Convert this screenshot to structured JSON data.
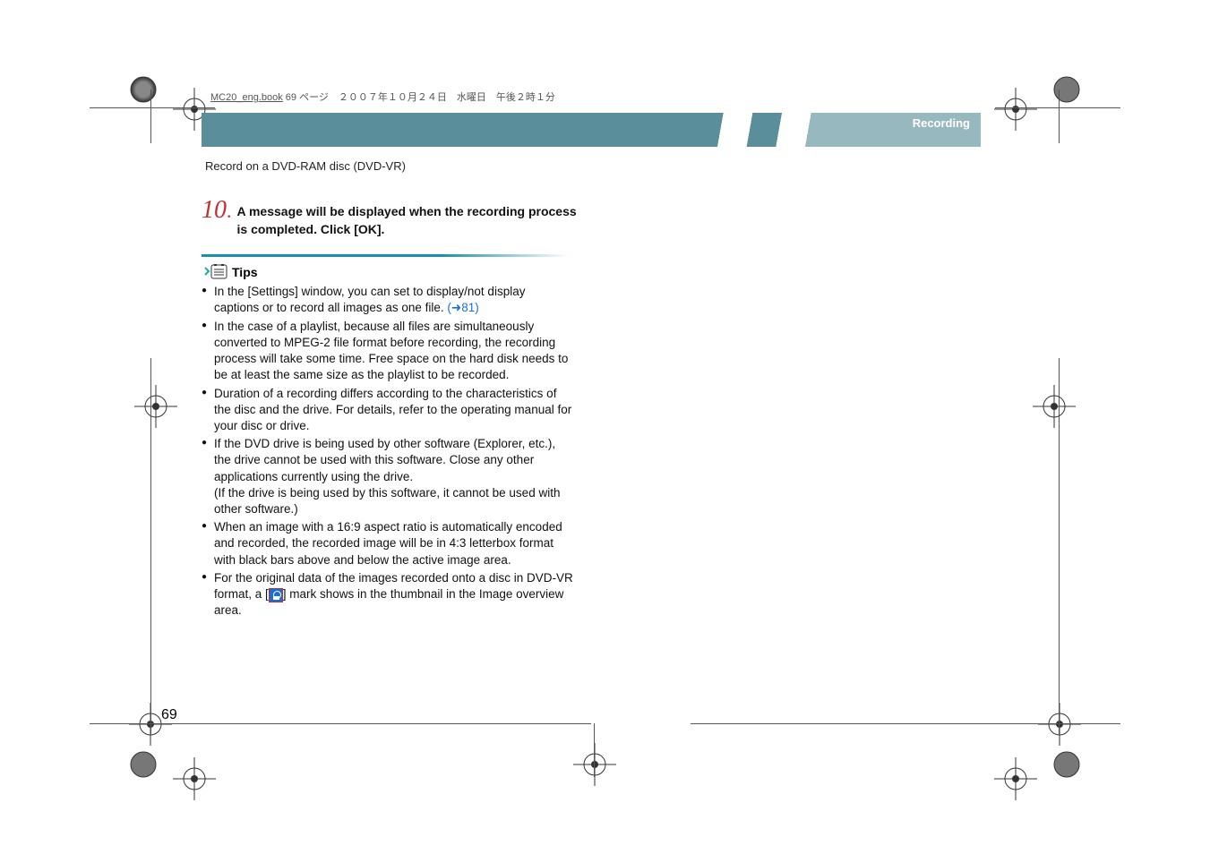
{
  "header": {
    "book_name": "MC20_eng.book",
    "page_info": "69 ページ　２００７年１０月２４日　水曜日　午後２時１分"
  },
  "banner": {
    "section_label": "Recording"
  },
  "subtitle": "Record on a DVD-RAM disc (DVD-VR)",
  "step": {
    "number": "10",
    "dot": ".",
    "text": "A message will be displayed when the recording process is completed. Click [OK]."
  },
  "tips": {
    "label": "Tips",
    "items": [
      {
        "text_a": "In the [Settings] window, you can set to display/not display captions or to record all images as one file. ",
        "link_prefix": "(➜",
        "link_num": "81",
        "link_suffix": ")"
      },
      {
        "text_a": "In the case of a playlist, because all files are simultaneously converted to MPEG-2 file format before recording, the recording process will take some time. Free space on the hard disk needs to be at least the same size as the playlist to be recorded."
      },
      {
        "text_a": "Duration of a recording differs according to the characteristics of the disc and the drive. For details, refer to the operating manual for your disc or drive."
      },
      {
        "text_a": "If the DVD drive is being used by other software (Explorer, etc.), the drive cannot be used with this software. Close any other applications currently using the drive.",
        "text_b": "(If the drive is being used by this software, it cannot be used with other software.)"
      },
      {
        "text_a": "When an image with a 16:9 aspect ratio is automatically encoded and recorded, the recorded image will be in 4:3 letterbox format with black bars above and below the active image area."
      },
      {
        "text_a": "For the original data of the images recorded onto a disc in DVD-VR format, a [",
        "has_icon": true,
        "text_c": "] mark shows in the thumbnail in the Image overview area."
      }
    ]
  },
  "page_number": "69"
}
